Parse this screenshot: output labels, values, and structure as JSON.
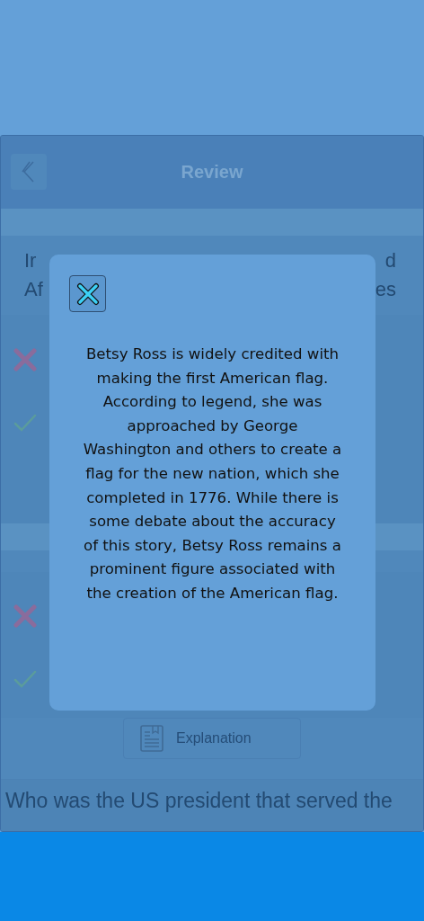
{
  "header": {
    "title": "Review"
  },
  "sections": [
    {
      "question_fragments": [
        {
          "left": "Ir",
          "right": "d"
        },
        {
          "left": "Af",
          "right": "es"
        }
      ],
      "answers": [
        {
          "kind": "wrong"
        },
        {
          "kind": "correct"
        }
      ]
    },
    {
      "answers": [
        {
          "kind": "wrong"
        },
        {
          "kind": "correct"
        }
      ]
    }
  ],
  "explanation_button": {
    "label": "Explanation"
  },
  "next_question": {
    "text": "Who was the US president that served the"
  },
  "modal": {
    "text": "Betsy Ross is widely credited with making the first American flag. According to legend, she was approached by George Washington and others to create a flag for the new nation, which she completed in 1776. While there is some debate about the accuracy of this story, Betsy Ross remains a prominent figure associated with the creation of the American flag."
  }
}
